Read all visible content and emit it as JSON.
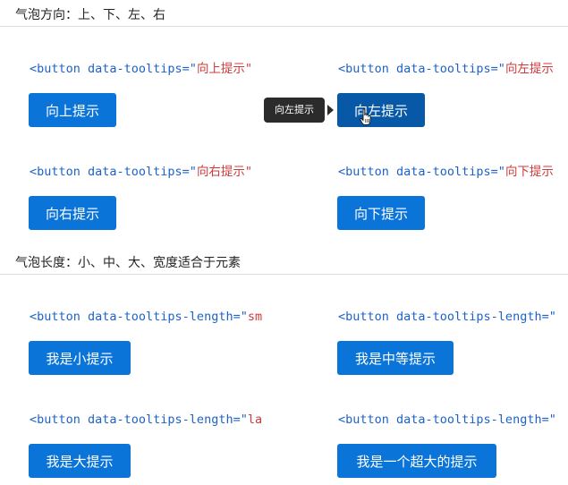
{
  "section1": {
    "title": "气泡方向：上、下、左、右",
    "snippets": [
      {
        "code": "<button data-tooltips=\"",
        "value": "向上提示\""
      },
      {
        "code": "<button data-tooltips=\"",
        "value": "向左提示"
      },
      {
        "code": "<button data-tooltips=\"",
        "value": "向右提示\""
      },
      {
        "code": "<button data-tooltips=\"",
        "value": "向下提示"
      }
    ],
    "buttons": [
      "向上提示",
      "向左提示",
      "向右提示",
      "向下提示"
    ],
    "tooltip": "向左提示"
  },
  "section2": {
    "title": "气泡长度：小、中、大、宽度适合于元素",
    "snippets": [
      {
        "code": "<button data-tooltips-length=\"",
        "value": "sm"
      },
      {
        "code": "<button data-tooltips-length=\"",
        "value": ""
      },
      {
        "code": "<button data-tooltips-length=\"",
        "value": "la"
      },
      {
        "code": "<button data-tooltips-length=\"",
        "value": ""
      }
    ],
    "buttons": [
      "我是小提示",
      "我是中等提示",
      "我是大提示",
      "我是一个超大的提示"
    ]
  },
  "colors": {
    "button": "#0a74d9",
    "button_active": "#0758a6",
    "code": "#1d62c8",
    "string": "#cc3b3b",
    "tooltip_bg": "#2b2b2b"
  }
}
